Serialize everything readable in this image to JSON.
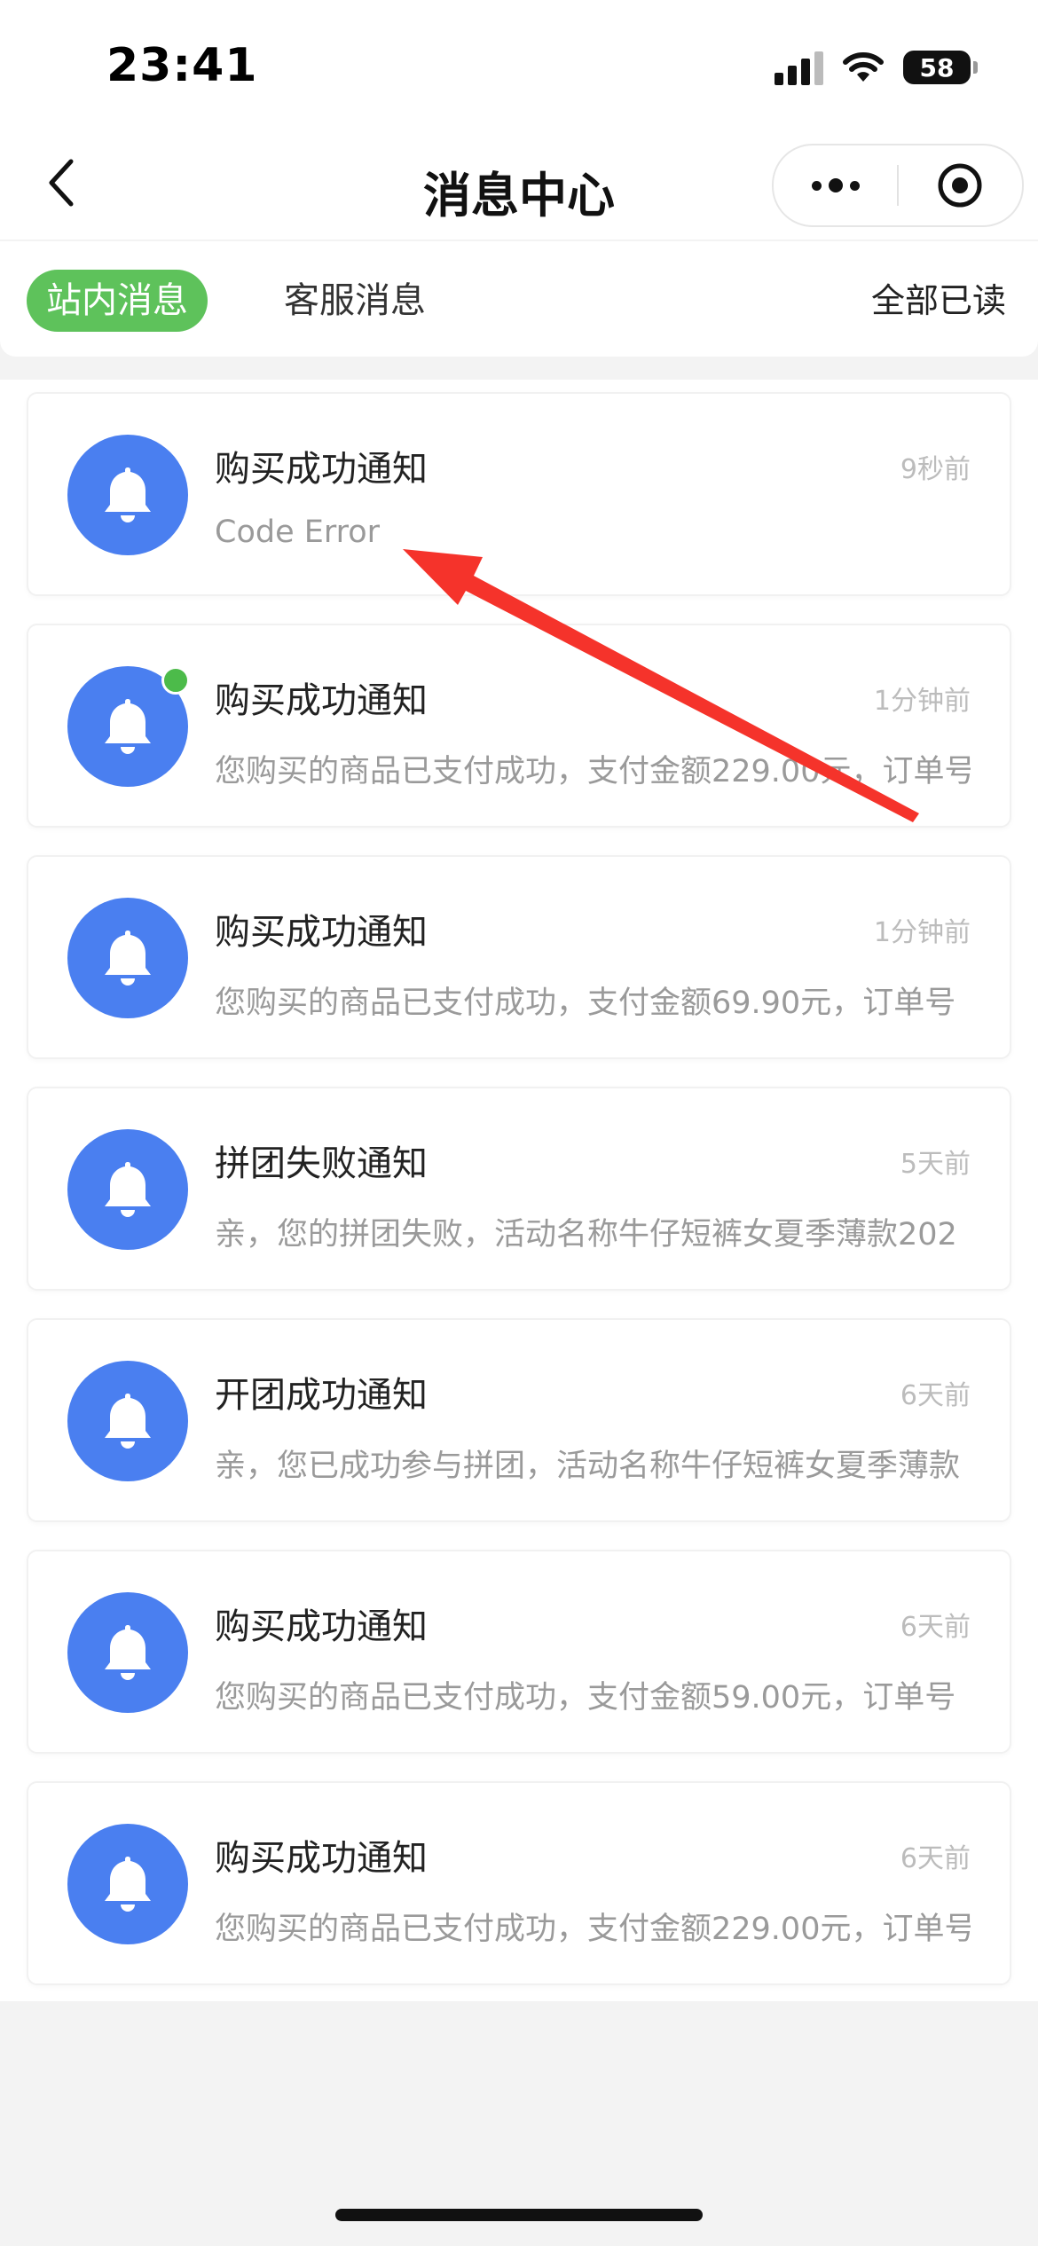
{
  "status_bar": {
    "time": "23:41",
    "battery": "58"
  },
  "nav": {
    "title": "消息中心"
  },
  "tabs": {
    "active": "站内消息",
    "inactive": "客服消息",
    "mark_all_read": "全部已读"
  },
  "messages": [
    {
      "title": "购买成功通知",
      "time": "9秒前",
      "body": "Code Error",
      "unread": false
    },
    {
      "title": "购买成功通知",
      "time": "1分钟前",
      "body": "您购买的商品已支付成功，支付金额229.00元，订单号",
      "unread": true
    },
    {
      "title": "购买成功通知",
      "time": "1分钟前",
      "body": "您购买的商品已支付成功，支付金额69.90元，订单号",
      "unread": false
    },
    {
      "title": "拼团失败通知",
      "time": "5天前",
      "body": "亲，您的拼团失败，活动名称牛仔短裤女夏季薄款202",
      "unread": false
    },
    {
      "title": "开团成功通知",
      "time": "6天前",
      "body": "亲，您已成功参与拼团，活动名称牛仔短裤女夏季薄款",
      "unread": false
    },
    {
      "title": "购买成功通知",
      "time": "6天前",
      "body": "您购买的商品已支付成功，支付金额59.00元，订单号",
      "unread": false
    },
    {
      "title": "购买成功通知",
      "time": "6天前",
      "body": "您购买的商品已支付成功，支付金额229.00元，订单号",
      "unread": false
    }
  ],
  "icons": {
    "avatar": "bell-icon",
    "back": "chevron-left-icon",
    "more": "more-dots-icon",
    "close": "target-circle-icon"
  },
  "colors": {
    "active_tab": "#5ec25b",
    "avatar": "#4a7ff0",
    "unread_dot": "#4cbb4a",
    "annotation_arrow": "#f5332b"
  }
}
